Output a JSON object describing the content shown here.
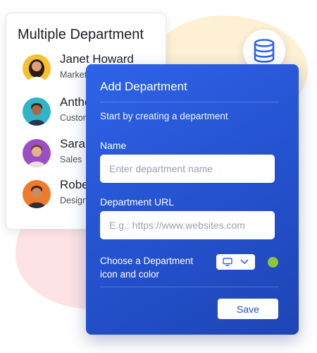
{
  "department_list": {
    "title": "Multiple Department",
    "members": [
      {
        "name": "Janet Howard",
        "role": "Marketing"
      },
      {
        "name": "Anthony",
        "role": "Customer Support"
      },
      {
        "name": "Sarah",
        "role": "Sales"
      },
      {
        "name": "Robert",
        "role": "Design"
      }
    ]
  },
  "header_icon": "database-icon",
  "modal": {
    "title": "Add Department",
    "subtitle": "Start by creating a department",
    "name_label": "Name",
    "name_placeholder": "Enter department name",
    "name_value": "",
    "url_label": "Department URL",
    "url_placeholder": "E.g.: https://www.websites.com",
    "url_value": "",
    "icon_color_label": "Choose a Department icon and color",
    "selected_icon": "monitor-icon",
    "selected_color": "#8cc63e",
    "save_label": "Save"
  },
  "colors": {
    "modal_background": "#2451cd",
    "accent": "#2f63e8",
    "background_blob_yellow": "#fdf0d3",
    "background_blob_pink": "#fde3e6"
  }
}
